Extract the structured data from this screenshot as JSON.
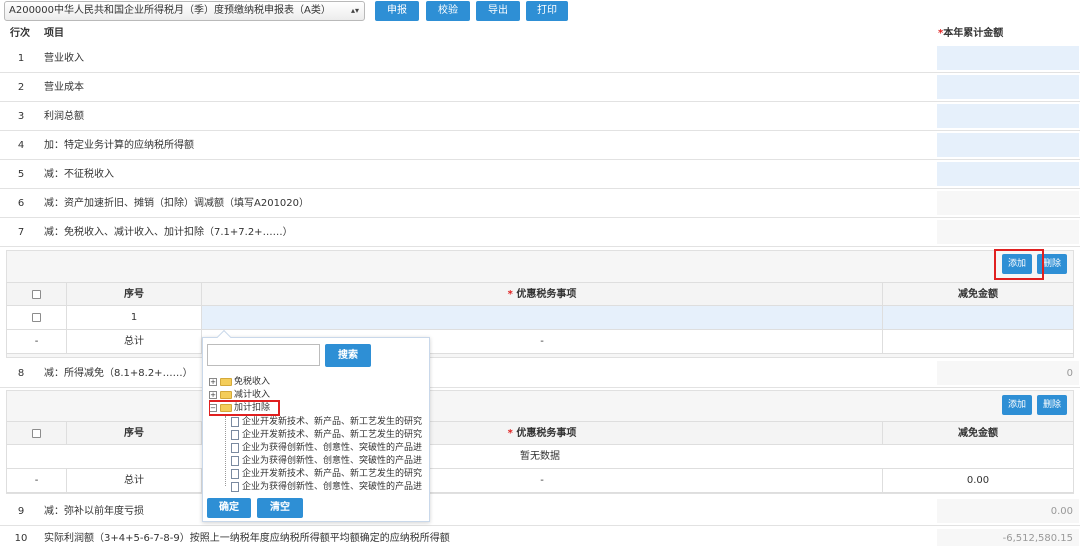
{
  "toolbar": {
    "form_select": "A200000中华人民共和国企业所得税月（季）度预缴纳税申报表（A类）",
    "declare": "申报",
    "verify": "校验",
    "export": "导出",
    "print": "打印"
  },
  "table_header": {
    "row_no": "行次",
    "item": "项目",
    "required_mark": "*",
    "amount": "本年累计金额"
  },
  "rows": [
    {
      "no": "1",
      "label": "营业收入",
      "value": ""
    },
    {
      "no": "2",
      "label": "营业成本",
      "value": ""
    },
    {
      "no": "3",
      "label": "利润总额",
      "value": ""
    },
    {
      "no": "4",
      "label": "加：特定业务计算的应纳税所得额",
      "value": ""
    },
    {
      "no": "5",
      "label": "减：不征税收入",
      "value": ""
    },
    {
      "no": "6",
      "label": "减：资产加速折旧、摊销（扣除）调减额（填写A201020）",
      "value": ""
    },
    {
      "no": "7",
      "label": "减：免税收入、减计收入、加计扣除（7.1+7.2+……）",
      "value": ""
    },
    {
      "no": "8",
      "label": "减：所得减免（8.1+8.2+……）",
      "value": "0"
    },
    {
      "no": "9",
      "label": "减：弥补以前年度亏损",
      "value": "0.00"
    },
    {
      "no": "10",
      "label": "实际利润额（3+4+5-6-7-8-9）按照上一纳税年度应纳税所得额平均额确定的应纳税所得额",
      "value": "-6,512,580.15"
    }
  ],
  "sub1": {
    "add": "添加",
    "delete": "删除",
    "col_seq": "序号",
    "col_required": "*",
    "col_item": "优惠税务事项",
    "col_amount": "减免金额",
    "row1_seq": "1",
    "total_dash": "-",
    "total_label": "总计",
    "total_item": "-"
  },
  "sub2": {
    "add": "添加",
    "delete": "删除",
    "col_seq": "序号",
    "col_required": "*",
    "col_item": "优惠税务事项",
    "col_amount": "减免金额",
    "empty": "暂无数据",
    "total_dash": "-",
    "total_label": "总计",
    "total_item": "-",
    "total_amount": "0.00"
  },
  "popup": {
    "search": "搜索",
    "confirm": "确定",
    "clear": "清空",
    "tree": [
      {
        "toggle": "+",
        "label": "免税收入"
      },
      {
        "toggle": "+",
        "label": "减计收入"
      },
      {
        "toggle": "−",
        "label": "加计扣除"
      }
    ],
    "children": [
      "企业开发新技术、新产品、新工艺发生的研究",
      "企业开发新技术、新产品、新工艺发生的研究",
      "企业为获得创新性、创意性、突破性的产品进",
      "企业为获得创新性、创意性、突破性的产品进",
      "企业开发新技术、新产品、新工艺发生的研究",
      "企业为获得创新性、创意性、突破性的产品进"
    ]
  }
}
